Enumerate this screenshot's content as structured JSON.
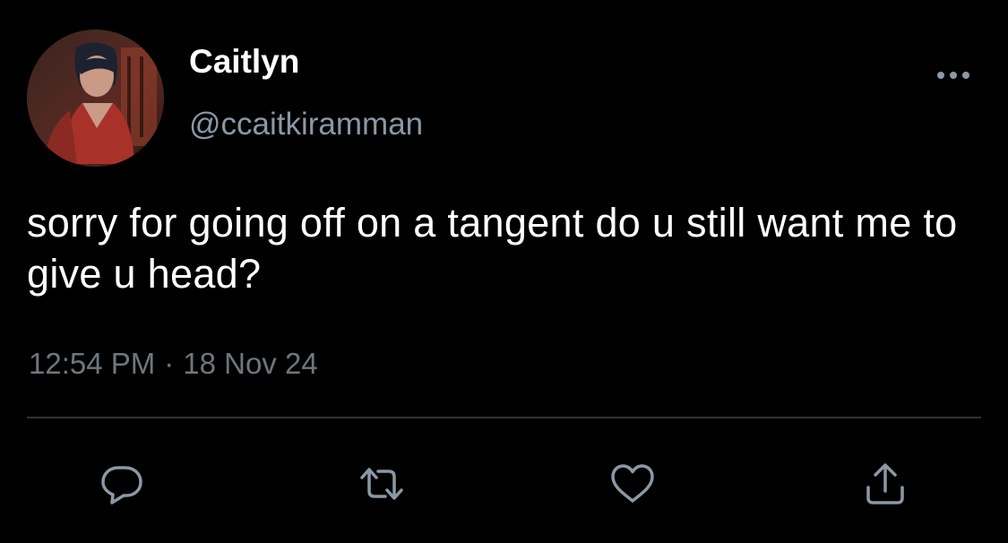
{
  "tweet": {
    "author": {
      "display_name": "Caitlyn",
      "handle": "@ccaitkiramman"
    },
    "text": "sorry for going off on a tangent do u still want me to give u head?",
    "time": "12:54 PM",
    "separator": "·",
    "date": "18 Nov 24"
  },
  "icons": {
    "more": "more-horizontal-icon",
    "reply": "reply-icon",
    "retweet": "retweet-icon",
    "like": "heart-icon",
    "share": "share-icon"
  },
  "colors": {
    "background": "#000000",
    "primary_text": "#ffffff",
    "secondary_text": "#8b98a5",
    "meta_text": "#6e767d",
    "icon": "#8b98a5",
    "divider": "#2f3336"
  }
}
